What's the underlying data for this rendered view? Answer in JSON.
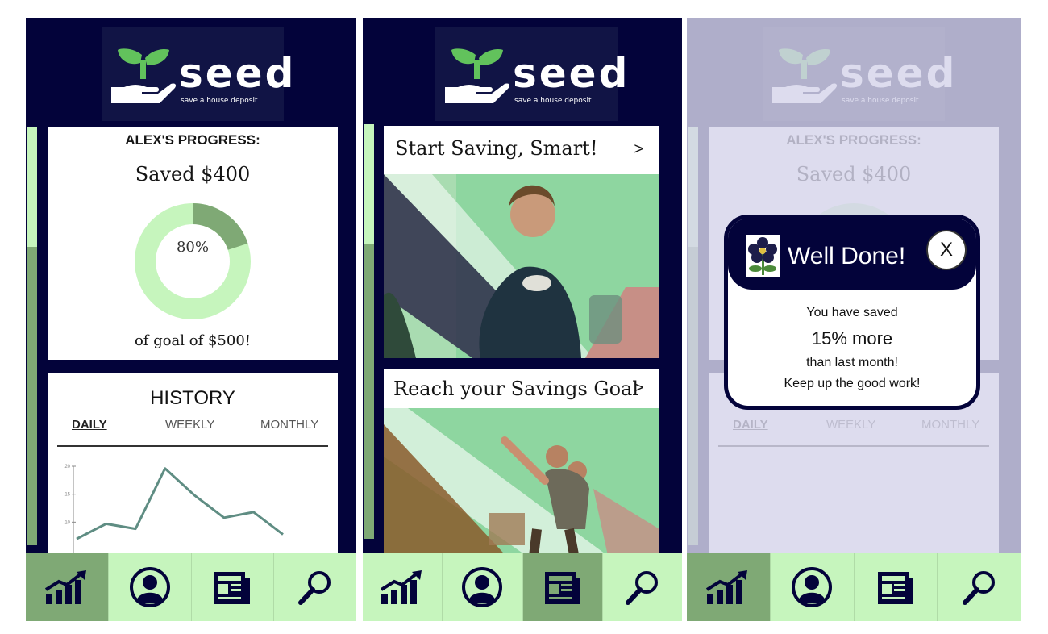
{
  "brand": {
    "name": "seed",
    "tagline": "save a house deposit"
  },
  "screen1": {
    "progress": {
      "title": "ALEX'S PROGRESS:",
      "saved": "Saved $400",
      "percent_label": "80%",
      "percent": 0.8,
      "goal": "of goal of $500!"
    },
    "history": {
      "title": "HISTORY",
      "tabs": [
        "DAILY",
        "WEEKLY",
        "MONTHLY"
      ],
      "active_tab": "DAILY",
      "y_ticks": [
        "20",
        "15",
        "10"
      ]
    }
  },
  "screen2": {
    "articles": [
      {
        "title": "Start Saving, Smart!",
        "arrow": ">"
      },
      {
        "title": "Reach your Savings Goal",
        "arrow": ">"
      }
    ]
  },
  "screen3": {
    "popup": {
      "title": "Well Done!",
      "close": "X",
      "line1": "You have saved",
      "line2": "15% more",
      "line3": "than last month!",
      "line4": "Keep up the good work!"
    }
  },
  "chart_data": {
    "type": "line",
    "x": [
      1,
      2,
      3,
      4,
      5,
      6,
      7,
      8
    ],
    "y": [
      7,
      9.7,
      8.8,
      19.6,
      14.8,
      10.8,
      11.8,
      7.8
    ],
    "ylim": [
      5,
      20
    ],
    "y_ticks": [
      "20",
      "15",
      "10"
    ]
  },
  "nav": [
    "chart-icon",
    "profile-icon",
    "news-icon",
    "search-icon"
  ],
  "colors": {
    "navy": "#03033a",
    "mint": "#c6f5bd",
    "sage": "#7fa975",
    "line": "#5f8d83"
  }
}
